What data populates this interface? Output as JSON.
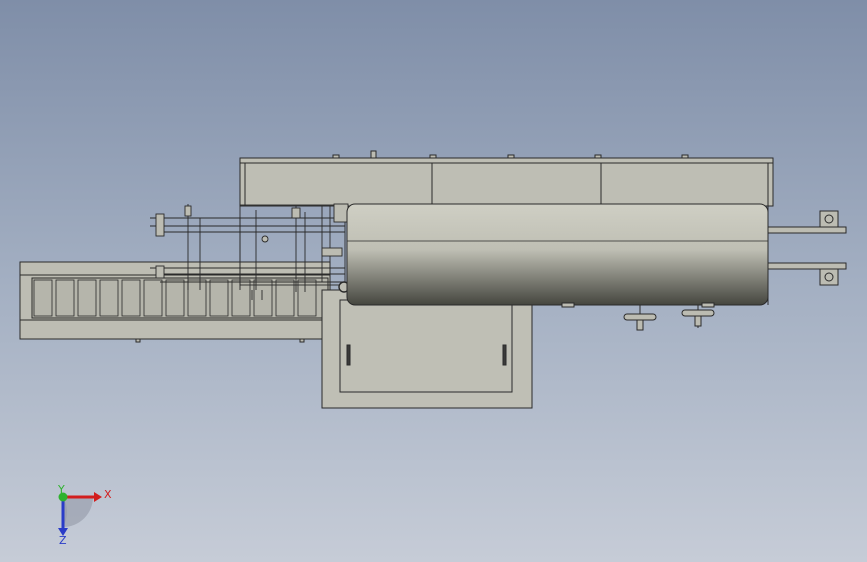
{
  "view": {
    "background_top": "#7f8ea8",
    "background_bottom": "#c6ccd7",
    "part_fill": "#bcbcb2",
    "part_stroke": "#2a2a2a",
    "drum_dark": "#4a4c46",
    "drum_light": "#d4d4c8"
  },
  "triad": {
    "x_label": "X",
    "y_label": "Y",
    "z_label": "Z",
    "x_color": "#d21e1e",
    "y_color": "#2fb22f",
    "z_color": "#2a3cc8"
  }
}
